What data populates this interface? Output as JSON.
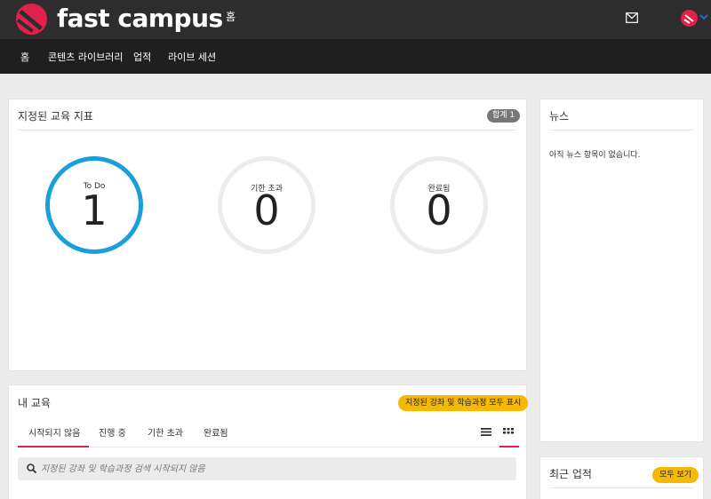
{
  "header": {
    "brand": "fast campus",
    "page_label": "홈",
    "icons": {
      "logo": "fastcampus-logo-icon",
      "mail": "mail-icon",
      "avatar": "user-avatar",
      "caret": "chevron-down-icon"
    },
    "colors": {
      "topbar": "#2d2d2d",
      "nav": "#1f1f1f",
      "brand_red": "#e0224b"
    }
  },
  "nav": {
    "items": [
      {
        "label": "홈"
      },
      {
        "label": "콘텐츠 라이브러리"
      },
      {
        "label": "업적"
      },
      {
        "label": "라이브 세션"
      }
    ]
  },
  "assigned": {
    "title": "지정된 교육 지표",
    "total_badge": "합계 1",
    "metrics": [
      {
        "label": "To Do",
        "count": "1",
        "color": "#1a9fd9"
      },
      {
        "label": "기한 초과",
        "count": "0",
        "color": "#ececec"
      },
      {
        "label": "완료됨",
        "count": "0",
        "color": "#ececec"
      }
    ]
  },
  "news": {
    "title": "뉴스",
    "empty_text": "아직 뉴스 항목이 없습니다."
  },
  "my_learning": {
    "title": "내 교육",
    "show_all_button": "지정된 강좌 및 학습과정 모두 표시",
    "tabs": [
      {
        "label": "시작되지 않음",
        "active": true
      },
      {
        "label": "진행 중"
      },
      {
        "label": "기한 초과"
      },
      {
        "label": "완료됨"
      }
    ],
    "view_icons": [
      "list-view-icon",
      "grid-view-icon"
    ],
    "active_view": "grid",
    "search": {
      "placeholder": "지정된 강좌 및 학습과정 검색 시작되지 않음"
    }
  },
  "recent": {
    "title": "최근 업적",
    "view_all_button": "모두 보기"
  }
}
